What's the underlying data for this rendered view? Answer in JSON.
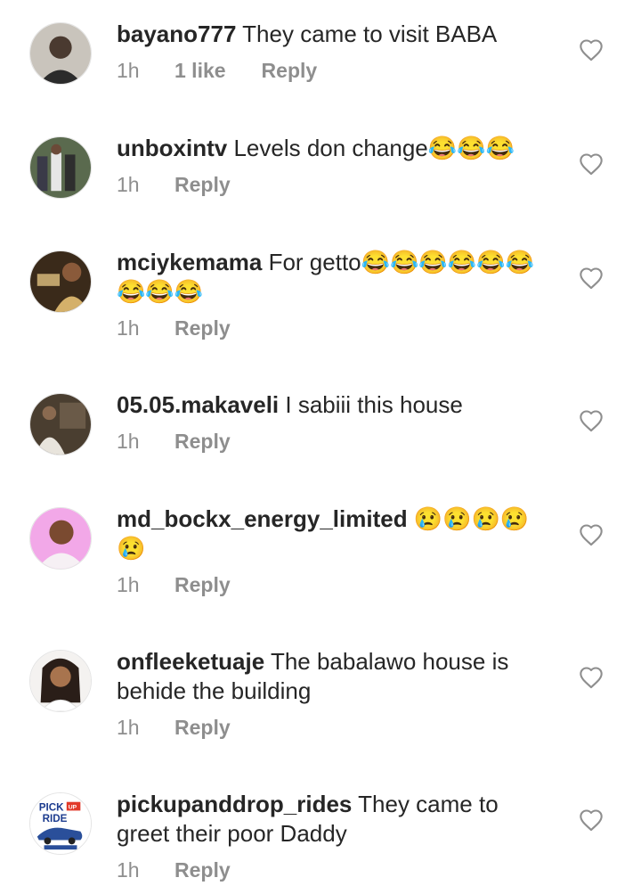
{
  "comments": [
    {
      "username": "bayano777",
      "text": "They came to visit BABA",
      "time": "1h",
      "likes": "1 like",
      "reply": "Reply"
    },
    {
      "username": "unboxintv",
      "text": "Levels don change😂😂😂",
      "time": "1h",
      "likes": "",
      "reply": "Reply"
    },
    {
      "username": "mciykemama",
      "text": "For getto😂😂😂😂😂😂😂😂😂",
      "time": "1h",
      "likes": "",
      "reply": "Reply"
    },
    {
      "username": "05.05.makaveli",
      "text": "I sabiii this house",
      "time": "1h",
      "likes": "",
      "reply": "Reply"
    },
    {
      "username": "md_bockx_energy_limited",
      "text": "😢😢😢😢😢",
      "time": "1h",
      "likes": "",
      "reply": "Reply"
    },
    {
      "username": "onfleeketuaje",
      "text": "The babalawo house is behide the building",
      "time": "1h",
      "likes": "",
      "reply": "Reply"
    },
    {
      "username": "pickupanddrop_rides",
      "text": "They came to greet their poor Daddy",
      "time": "1h",
      "likes": "",
      "reply": "Reply",
      "avatar_text": [
        "PICK",
        "UP",
        "RIDE"
      ]
    }
  ],
  "colors": {
    "text": "#262626",
    "meta": "#8e8e8e"
  },
  "icons": {
    "like": "heart-outline-icon"
  }
}
